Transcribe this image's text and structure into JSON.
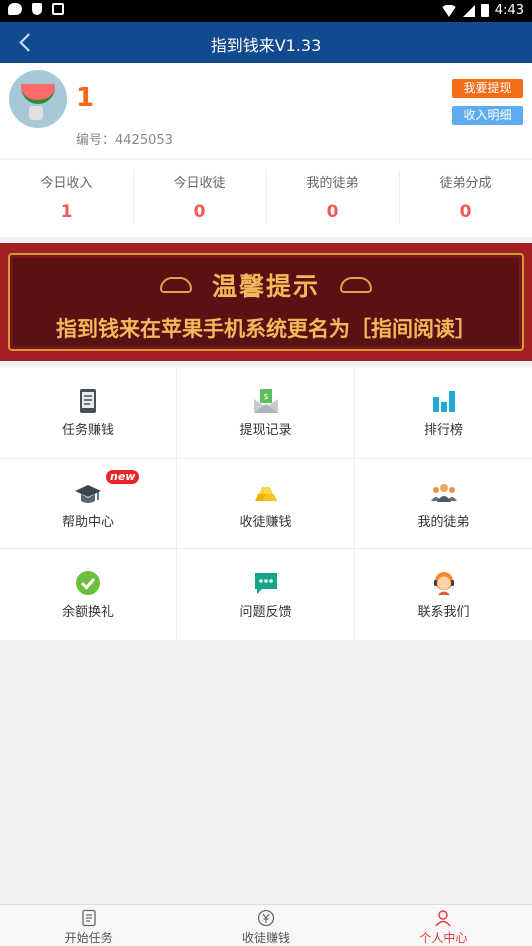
{
  "status_bar": {
    "time": "4:43"
  },
  "header": {
    "title": "指到钱来V1.33"
  },
  "profile": {
    "name": "1",
    "id_label": "编号：4425053",
    "withdraw_button": "我要提现",
    "income_detail_button": "收入明细"
  },
  "stats": [
    {
      "label": "今日收入",
      "value": "1"
    },
    {
      "label": "今日收徒",
      "value": "0"
    },
    {
      "label": "我的徒弟",
      "value": "0"
    },
    {
      "label": "徒弟分成",
      "value": "0"
    }
  ],
  "banner": {
    "title": "温馨提示",
    "subtitle": "指到钱来在苹果手机系统更名为［指间阅读］"
  },
  "menu": [
    {
      "label": "任务赚钱",
      "icon": "tablet-icon"
    },
    {
      "label": "提现记录",
      "icon": "money-envelope-icon"
    },
    {
      "label": "排行榜",
      "icon": "bar-chart-icon"
    },
    {
      "label": "帮助中心",
      "icon": "graduation-cap-icon",
      "badge": "new"
    },
    {
      "label": "收徒赚钱",
      "icon": "gold-bars-icon"
    },
    {
      "label": "我的徒弟",
      "icon": "people-icon"
    },
    {
      "label": "余额换礼",
      "icon": "check-badge-icon"
    },
    {
      "label": "问题反馈",
      "icon": "chat-bubble-icon"
    },
    {
      "label": "联系我们",
      "icon": "support-agent-icon"
    }
  ],
  "bottom_nav": [
    {
      "label": "开始任务",
      "icon": "document-icon"
    },
    {
      "label": "收徒赚钱",
      "icon": "yuan-coin-icon"
    },
    {
      "label": "个人中心",
      "icon": "person-icon",
      "active": true
    }
  ],
  "colors": {
    "header_bg": "#124a8f",
    "accent_orange": "#f46b18",
    "accent_blue": "#5cacef",
    "stat_value": "#ee5a5a",
    "banner_bg": "#a21f22",
    "banner_text": "#f4b85a",
    "active_tab": "#e23b3b"
  }
}
